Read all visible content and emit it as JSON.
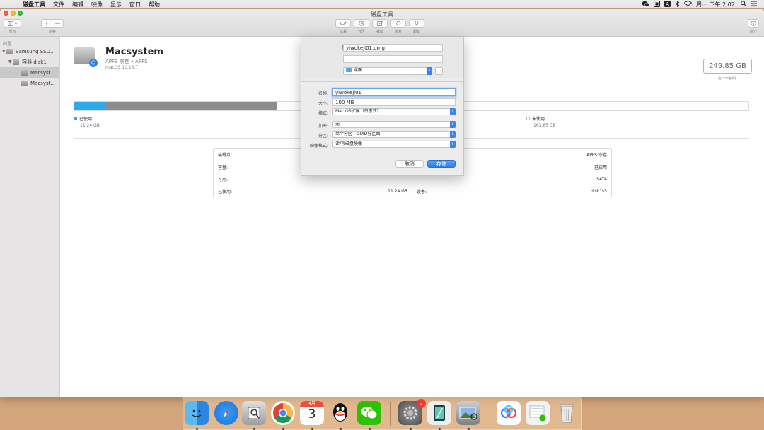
{
  "menubar": {
    "app_name": "磁盘工具",
    "items": [
      "文件",
      "编辑",
      "映像",
      "显示",
      "窗口",
      "帮助"
    ],
    "clock": "周一 下午 2:02"
  },
  "window": {
    "title": "磁盘工具",
    "toolbar": {
      "view_label": "显示",
      "volume_label": "宗卷",
      "volume_plus": "+",
      "volume_minus": "—",
      "actions": [
        "急救",
        "分区",
        "抹掉",
        "恢复",
        "卸载"
      ],
      "info_label": "简介"
    }
  },
  "sidebar": {
    "header": "内置",
    "items": [
      {
        "label": "Samsung SSD..."
      },
      {
        "label": "容器 disk1"
      },
      {
        "label": "Macsyst..."
      },
      {
        "label": "Macsyst..."
      }
    ]
  },
  "volume": {
    "name": "Macsystem",
    "subtitle": "APFS 宗卷 • APFS",
    "os": "macOS 10.15.7",
    "capacity": "249.85 GB",
    "capacity_label": "由4个宗卷共享",
    "used_label": "已使用",
    "used_value": "11.24 GB",
    "free_label": "未使用",
    "free_value": "163.85 GB",
    "used_fraction": 0.045,
    "other_fraction": 0.255,
    "colors": {
      "used": "#2ca8ec",
      "other": "#8c8c8c"
    }
  },
  "info_table": [
    {
      "left_label": "装载点:",
      "left_value": "",
      "right_label": "",
      "right_value": "APFS 宗卷"
    },
    {
      "left_label": "容量:",
      "left_value": "",
      "right_label": "",
      "right_value": "已启用"
    },
    {
      "left_label": "可用:",
      "left_value": "",
      "right_label": "",
      "right_value": "SATA"
    },
    {
      "left_label": "已使用:",
      "left_value": "11.24 GB",
      "right_label": "设备:",
      "right_value": "disk1s5"
    }
  ],
  "dialog": {
    "save_as_label": "存储为:",
    "save_as_value": "yiwokeji01.dmg",
    "tags_label": "标签:",
    "tags_value": "",
    "location_label": "位置:",
    "location_value": "桌面",
    "name_label": "名称:",
    "name_value": "yiwokeji01",
    "size_label": "大小:",
    "size_value": "100 MB",
    "format_label": "格式:",
    "format_value": "Mac OS扩展（日志式）",
    "encryption_label": "加密:",
    "encryption_value": "无",
    "partitions_label": "分区:",
    "partitions_value": "单个分区 - GUID分区图",
    "image_format_label": "映像格式:",
    "image_format_value": "读/写磁盘映像",
    "cancel": "取消",
    "save": "存储"
  },
  "dock": {
    "items": [
      "finder-icon",
      "safari-icon",
      "preview-icon",
      "chrome-icon",
      "calendar-icon",
      "qq-icon",
      "wechat-icon",
      "system-preferences-icon",
      "notes-icon",
      "image-capture-icon",
      "baidu-netdisk-icon",
      "wechat-file-icon",
      "trash-icon"
    ],
    "calendar_month": "4月",
    "calendar_day": "3",
    "prefs_badge": "2"
  }
}
